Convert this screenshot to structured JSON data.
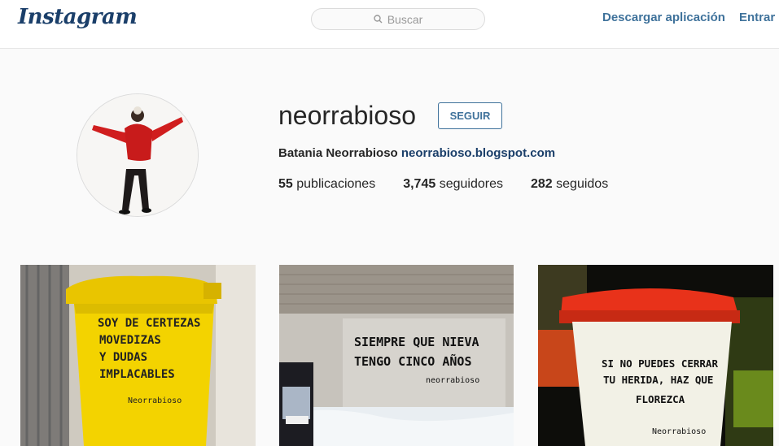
{
  "header": {
    "logo": "Instagram",
    "search_placeholder": "Buscar",
    "download_label": "Descargar aplicación",
    "login_label": "Entrar"
  },
  "profile": {
    "username": "neorrabioso",
    "follow_label": "SEGUIR",
    "full_name": "Batania Neorrabioso",
    "website": "neorrabioso.blogspot.com",
    "posts_count": "55",
    "posts_label": "publicaciones",
    "followers_count": "3,745",
    "followers_label": "seguidores",
    "following_count": "282",
    "following_label": "seguidos"
  },
  "posts": [
    {
      "lines": [
        "SOY DE CERTEZAS",
        "MOVEDIZAS",
        "Y DUDAS",
        "IMPLACABLES"
      ],
      "signature": "Neorrabioso"
    },
    {
      "lines": [
        "SIEMPRE QUE NIEVA",
        "TENGO CINCO AÑOS"
      ],
      "signature": "neorrabioso"
    },
    {
      "lines": [
        "SI NO PUEDES CERRAR",
        "TU HERIDA, HAZ QUE",
        "FLOREZCA"
      ],
      "signature": "Neorrabioso"
    }
  ],
  "colors": {
    "brand": "#3f729b",
    "logo": "#1b3f6a"
  }
}
